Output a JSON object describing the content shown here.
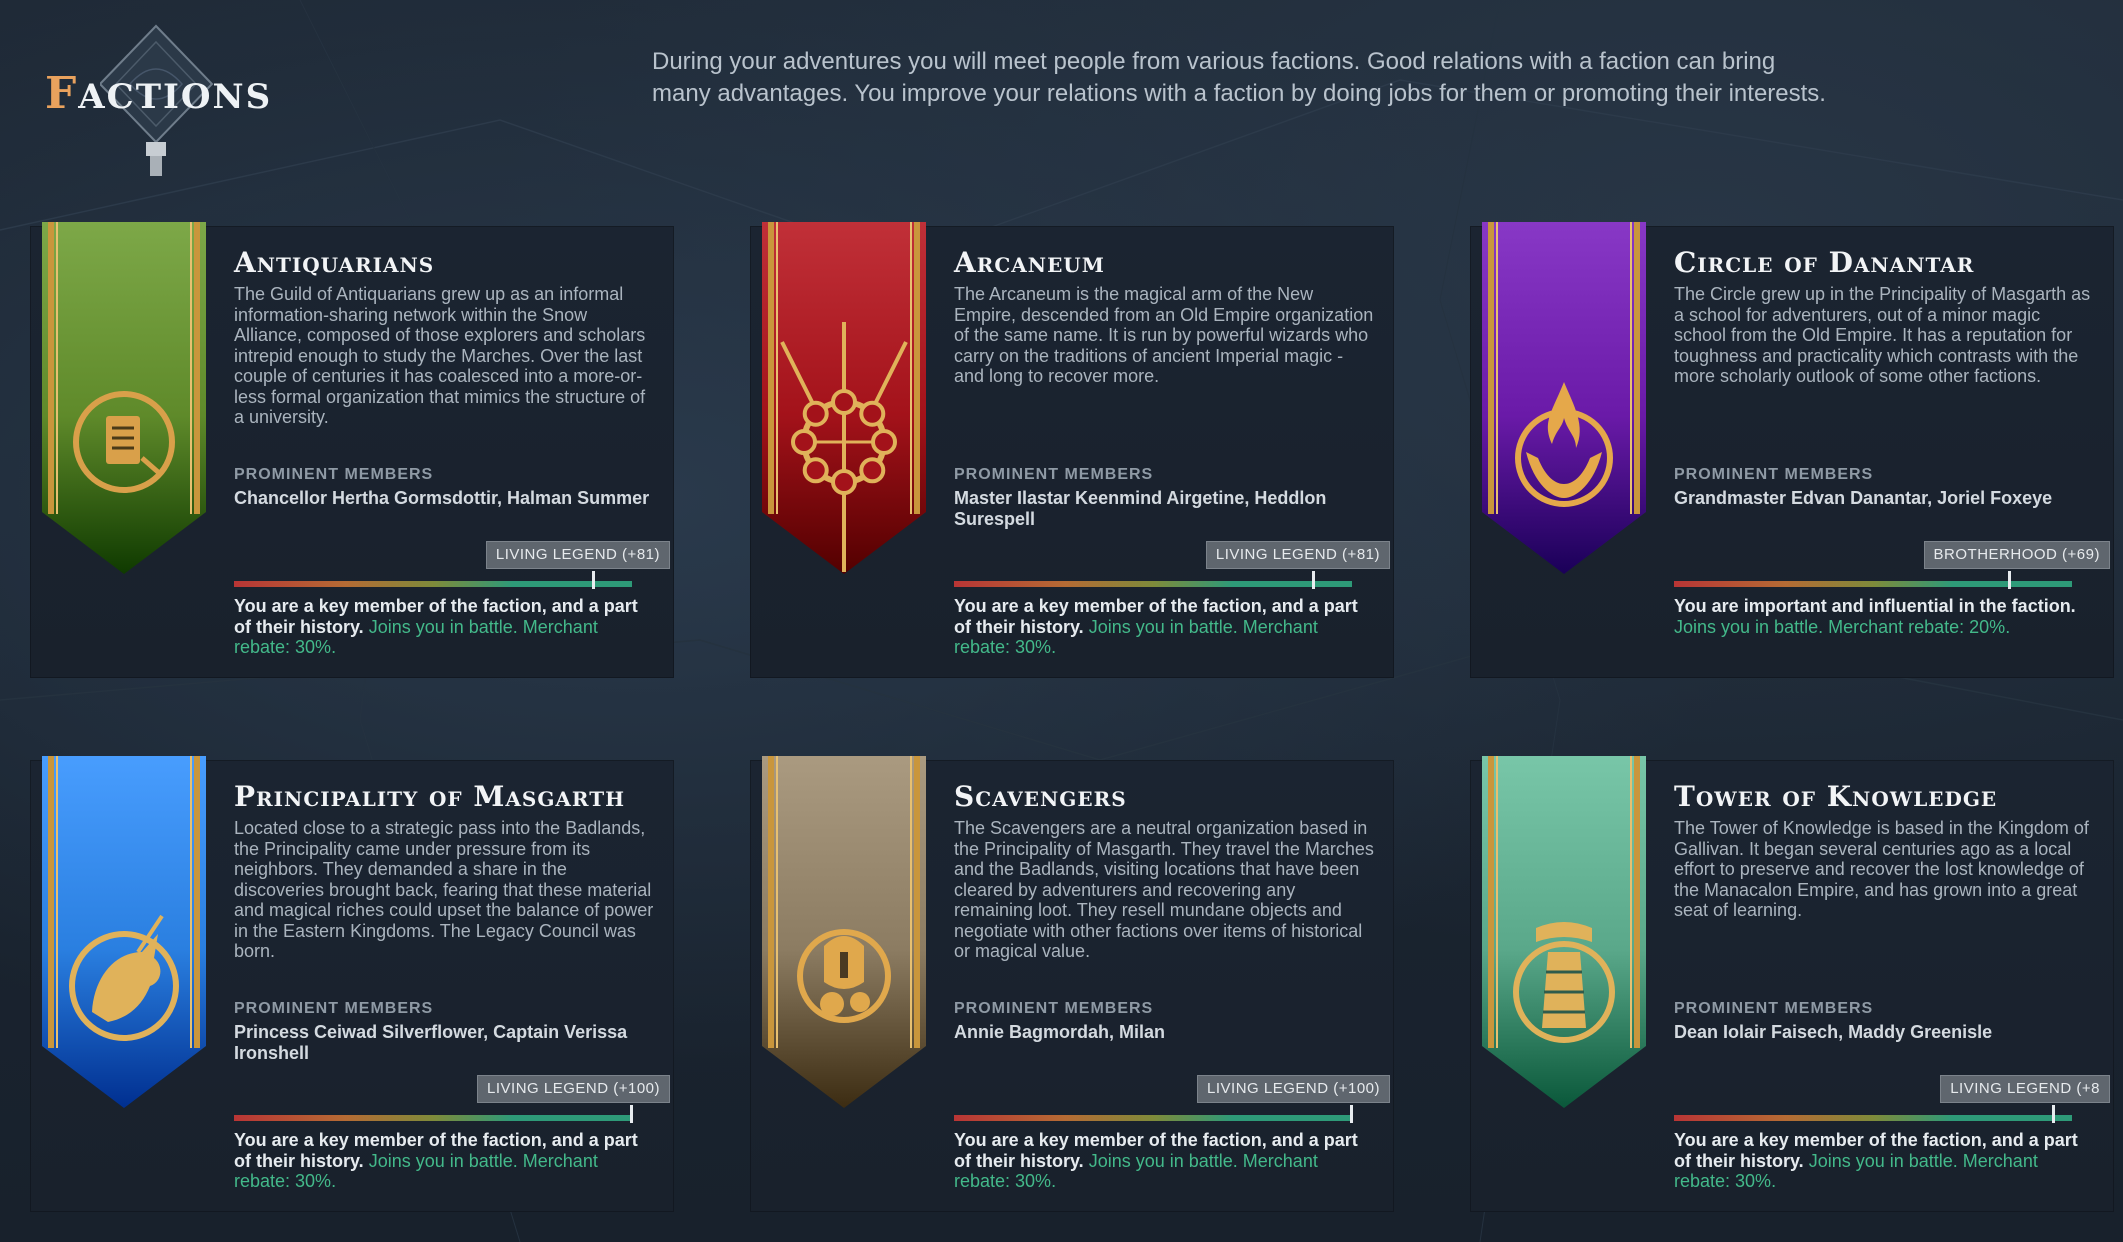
{
  "page": {
    "title_first": "F",
    "title_rest": "actions",
    "intro": "During your adventures you will meet people from various factions. Good relations with a faction can bring many advantages. You improve your relations with a faction by doing jobs for them or promoting their interests."
  },
  "members_label": "PROMINENT MEMBERS",
  "factions": [
    {
      "name": "Antiquarians",
      "description": "The Guild of Antiquarians grew up as an informal information-sharing network within the Snow Alliance, composed of those explorers and scholars intrepid enough to study the Marches. Over the last couple of centuries it has coalesced into a more-or-less formal organization that mimics the structure of a university.",
      "members": "Chancellor Hertha Gormsdottir, Halman Summer",
      "rank": "LIVING LEGEND (+81)",
      "reputation": 81,
      "status": "You are a key member of the faction, and a part of their history.",
      "benefits": "Joins you in battle. Merchant rebate: 30%.",
      "banner_color": "#5f8a2a",
      "emblem": "scroll-quill-icon"
    },
    {
      "name": "Arcaneum",
      "description": "The Arcaneum is the magical arm of the New Empire, descended from an Old Empire organization of the same name. It is run by powerful wizards who carry on the traditions of ancient Imperial magic - and long to recover more.",
      "members": "Master Ilastar Keenmind Airgetine, Heddlon Surespell",
      "rank": "LIVING LEGEND (+81)",
      "reputation": 81,
      "status": "You are a key member of the faction, and a part of their history.",
      "benefits": "Joins you in battle. Merchant rebate: 30%.",
      "banner_color": "#a3121a",
      "emblem": "arcane-wheel-icon"
    },
    {
      "name": "Circle of Danantar",
      "description": "The Circle grew up in the Principality of Masgarth as a school for adventurers, out of a minor magic school from the Old Empire. It has a reputation for toughness and practicality which contrasts with the more scholarly outlook of some other factions.",
      "members": "Grandmaster Edvan Danantar, Joriel Foxeye",
      "rank": "BROTHERHOOD (+69)",
      "reputation": 69,
      "status": "You are important and influential in the faction.",
      "benefits": "Joins you in battle. Merchant rebate: 20%.",
      "banner_color": "#6a1aa8",
      "emblem": "flame-hands-icon"
    },
    {
      "name": "Principality of Masgarth",
      "description": "Located close to a strategic pass into the Badlands, the Principality came under pressure from its neighbors. They demanded a share in the discoveries brought back, fearing that these material and magical riches could upset the balance of power in the Eastern Kingdoms. The Legacy Council was born.",
      "members": "Princess Ceiwad Silverflower, Captain Verissa Ironshell",
      "rank": "LIVING LEGEND (+100)",
      "reputation": 100,
      "status": "You are a key member of the faction, and a part of their history.",
      "benefits": "Joins you in battle. Merchant rebate: 30%.",
      "banner_color": "#2a7fe0",
      "emblem": "unicorn-icon"
    },
    {
      "name": "Scavengers",
      "description": "The Scavengers are a neutral organization based in the Principality of Masgarth. They travel the Marches and the Badlands, visiting locations that have been cleared by adventurers and recovering any remaining loot. They resell mundane objects and negotiate with other factions over items of historical or magical value.",
      "members": "Annie Bagmordah, Milan",
      "rank": "LIVING LEGEND (+100)",
      "reputation": 100,
      "status": "You are a key member of the faction, and a part of their history.",
      "benefits": "Joins you in battle. Merchant rebate: 30%.",
      "banner_color": "#8c7c62",
      "emblem": "helmet-potion-icon"
    },
    {
      "name": "Tower of Knowledge",
      "description": "The Tower of Knowledge is based in the Kingdom of Gallivan. It began several centuries ago as a local effort to preserve and recover the lost knowledge of the Manacalon Empire, and has grown into a great seat of learning.",
      "members": "Dean Iolair Faisech, Maddy Greenisle",
      "rank": "LIVING LEGEND (+8",
      "reputation": 91,
      "status": "You are a key member of the faction, and a part of their history.",
      "benefits": "Joins you in battle. Merchant rebate: 30%.",
      "banner_color": "#5aa88a",
      "emblem": "book-tower-icon"
    }
  ]
}
